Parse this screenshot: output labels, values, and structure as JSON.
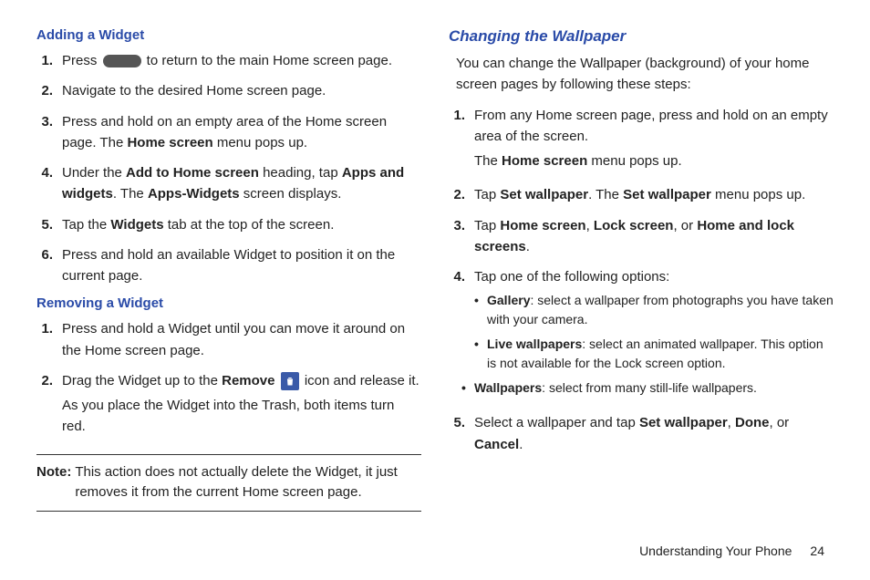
{
  "left": {
    "heading1": "Adding a Widget",
    "steps1": [
      {
        "n": "1.",
        "pre": "Press ",
        "post": " to return to the main Home screen page."
      },
      {
        "n": "2.",
        "text": "Navigate to the desired Home screen page."
      },
      {
        "n": "3.",
        "pre": "Press and hold on an empty area of the Home screen page. The ",
        "b1": "Home screen",
        "post": " menu pops up."
      },
      {
        "n": "4.",
        "pre": "Under the ",
        "b1": "Add to Home screen",
        "mid1": " heading, tap ",
        "b2": "Apps and widgets",
        "mid2": ". The ",
        "b3": "Apps-Widgets",
        "post": " screen displays."
      },
      {
        "n": "5.",
        "pre": "Tap the ",
        "b1": "Widgets",
        "post": " tab at the top of the screen."
      },
      {
        "n": "6.",
        "text": "Press and hold an available Widget to position it on the current page."
      }
    ],
    "heading2": "Removing a Widget",
    "steps2": [
      {
        "n": "1.",
        "text": "Press and hold a Widget until you can move it around on the Home screen page."
      },
      {
        "n": "2.",
        "pre": "Drag the Widget up to the ",
        "b1": "Remove",
        "post": " icon and release it.",
        "extra": "As you place the Widget into the Trash, both items turn red."
      }
    ],
    "note_label": "Note:",
    "note_text": "This action does not actually delete the Widget, it just removes it from the current Home screen page."
  },
  "right": {
    "heading": "Changing the Wallpaper",
    "intro": "You can change the Wallpaper (background) of your home screen pages by following these steps:",
    "steps": [
      {
        "n": "1.",
        "text": "From any Home screen page, press and hold on an empty area of the screen.",
        "extra_pre": "The ",
        "extra_b": "Home screen",
        "extra_post": " menu pops up."
      },
      {
        "n": "2.",
        "pre": "Tap ",
        "b1": "Set wallpaper",
        "mid1": ". The ",
        "b2": "Set wallpaper",
        "post": " menu pops up."
      },
      {
        "n": "3.",
        "pre": "Tap ",
        "b1": "Home screen",
        "mid1": ", ",
        "b2": "Lock screen",
        "mid2": ", or ",
        "b3": "Home and lock screens",
        "post": "."
      },
      {
        "n": "4.",
        "text": "Tap one of the following options:",
        "bullets": [
          {
            "b": "Gallery",
            "rest": ": select a wallpaper from photographs you have taken with your camera."
          },
          {
            "b": "Live wallpapers",
            "rest": ": select an animated wallpaper. This option is not available for the Lock screen option."
          },
          {
            "b": "Wallpapers",
            "rest": ": select from many still-life wallpapers."
          }
        ]
      },
      {
        "n": "5.",
        "pre": "Select a wallpaper and tap ",
        "b1": "Set wallpaper",
        "mid1": ", ",
        "b2": "Done",
        "mid2": ", or ",
        "b3": "Cancel",
        "post": "."
      }
    ]
  },
  "footer": {
    "section": "Understanding Your Phone",
    "page": "24"
  }
}
